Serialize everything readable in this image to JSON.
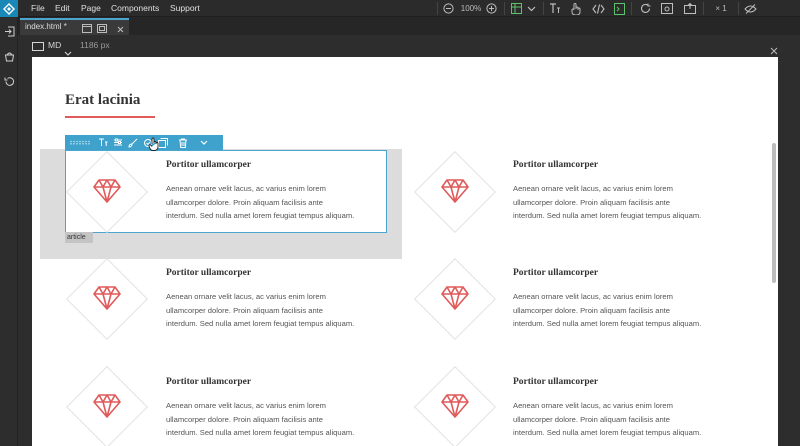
{
  "menu": {
    "file": "File",
    "edit": "Edit",
    "page": "Page",
    "components": "Components",
    "support": "Support"
  },
  "toolbar": {
    "zoom": "100%",
    "copies": "× 1"
  },
  "tab": {
    "filename": "index.html",
    "modified": "*"
  },
  "viewport": {
    "device": "MD",
    "width": "1186 px"
  },
  "page": {
    "section_title": "Erat lacinia",
    "selection_tag": "article",
    "cards": [
      {
        "title": "Portitor ullamcorper",
        "line1": "Aenean ornare velit lacus, ac varius enim lorem",
        "line2": "ullamcorper dolore. Proin aliquam facilisis ante",
        "line3": "interdum. Sed nulla amet lorem feugiat tempus aliquam."
      },
      {
        "title": "Portitor ullamcorper",
        "line1": "Aenean ornare velit lacus, ac varius enim lorem",
        "line2": "ullamcorper dolore. Proin aliquam facilisis ante",
        "line3": "interdum. Sed nulla amet lorem feugiat tempus aliquam."
      },
      {
        "title": "Portitor ullamcorper",
        "line1": "Aenean ornare velit lacus, ac varius enim lorem",
        "line2": "ullamcorper dolore. Proin aliquam facilisis ante",
        "line3": "interdum. Sed nulla amet lorem feugiat tempus aliquam."
      },
      {
        "title": "Portitor ullamcorper",
        "line1": "Aenean ornare velit lacus, ac varius enim lorem",
        "line2": "ullamcorper dolore. Proin aliquam facilisis ante",
        "line3": "interdum. Sed nulla amet lorem feugiat tempus aliquam."
      },
      {
        "title": "Portitor ullamcorper",
        "line1": "Aenean ornare velit lacus, ac varius enim lorem",
        "line2": "ullamcorper dolore. Proin aliquam facilisis ante",
        "line3": "interdum. Sed nulla amet lorem feugiat tempus aliquam."
      },
      {
        "title": "Portitor ullamcorper",
        "line1": "Aenean ornare velit lacus, ac varius enim lorem",
        "line2": "ullamcorper dolore. Proin aliquam facilisis ante",
        "line3": "interdum. Sed nulla amet lorem feugiat tempus aliquam."
      }
    ]
  },
  "colors": {
    "accent": "#e05a5a",
    "selection": "#3ea2cc",
    "brand": "#1a88b6"
  }
}
